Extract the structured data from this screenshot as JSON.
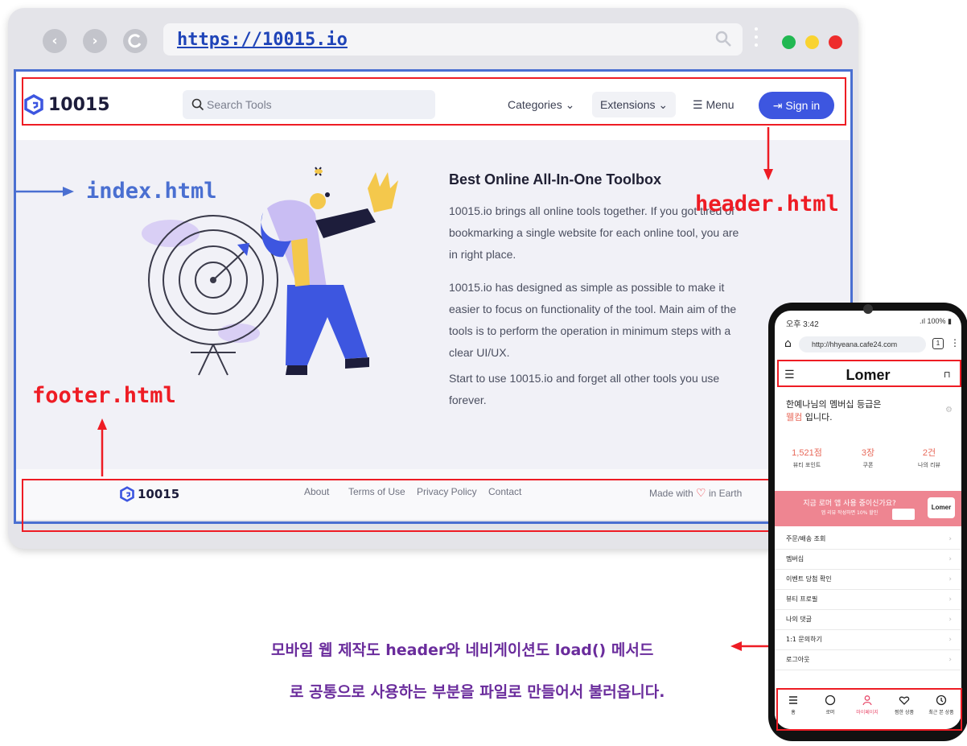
{
  "browser": {
    "url": "https://10015.io",
    "window_dots": [
      "#21b852",
      "#f9d330",
      "#ee2d2d"
    ]
  },
  "site": {
    "logo_text": "10015",
    "search_placeholder": "Search Tools",
    "nav": {
      "categories": "Categories",
      "extensions": "Extensions",
      "menu": "Menu",
      "signin": "Sign in"
    },
    "hero": {
      "title": "Best Online All-In-One Toolbox",
      "paragraphs": [
        "10015.io brings all online tools together. If you got tired of bookmarking a single website for each online tool, you are in right place.",
        "10015.io has designed as simple as possible to make it easier to focus on functionality of the tool. Main aim of the tools is to perform the operation in minimum steps with a clear UI/UX.",
        "Start to use 10015.io and forget all other tools you use forever."
      ]
    },
    "footer": {
      "logo_text": "10015",
      "links": [
        "About",
        "Terms of Use",
        "Privacy Policy",
        "Contact"
      ],
      "made_with_prefix": "Made with",
      "made_with_suffix": "in Earth"
    }
  },
  "annotations": {
    "index_label": "index.html",
    "header_label": "header.html",
    "footer_label": "footer.html",
    "caption_line1": "모바일 웹 제작도 header와 네비게이션도 load() 메서드",
    "caption_line2": "로 공통으로 사용하는 부분을 파일로 만들어서 불러옵니다.",
    "red": "#ee1c24",
    "blue": "#4a6fd1"
  },
  "phone": {
    "status_time": "오후 3:42",
    "status_right": "100%",
    "url": "http://hhyeana.cafe24.com",
    "tab_count": "1",
    "title": "Lomer",
    "greeting_line1": "한예나님의 멤버십 등급은",
    "greeting_grade": "웰컴",
    "greeting_suffix": " 입니다.",
    "stats": [
      {
        "value": "1,521점",
        "label": "뷰티 포인트"
      },
      {
        "value": "3장",
        "label": "쿠폰"
      },
      {
        "value": "2건",
        "label": "나의 리뷰"
      }
    ],
    "banner_title": "지금 로머 앱 사용 중이신가요?",
    "banner_sub": "앱 리뷰 작성하면 10% 할인",
    "banner_logo": "Lomer",
    "menu": [
      "주문/배송 조회",
      "멤버십",
      "이벤트 당첨 확인",
      "뷰티 프로필",
      "나의 댓글",
      "1:1 문의하기",
      "로그아웃"
    ],
    "tabs": [
      "홈",
      "로머",
      "마이페이지",
      "찜한 상품",
      "최근 본 상품"
    ]
  }
}
